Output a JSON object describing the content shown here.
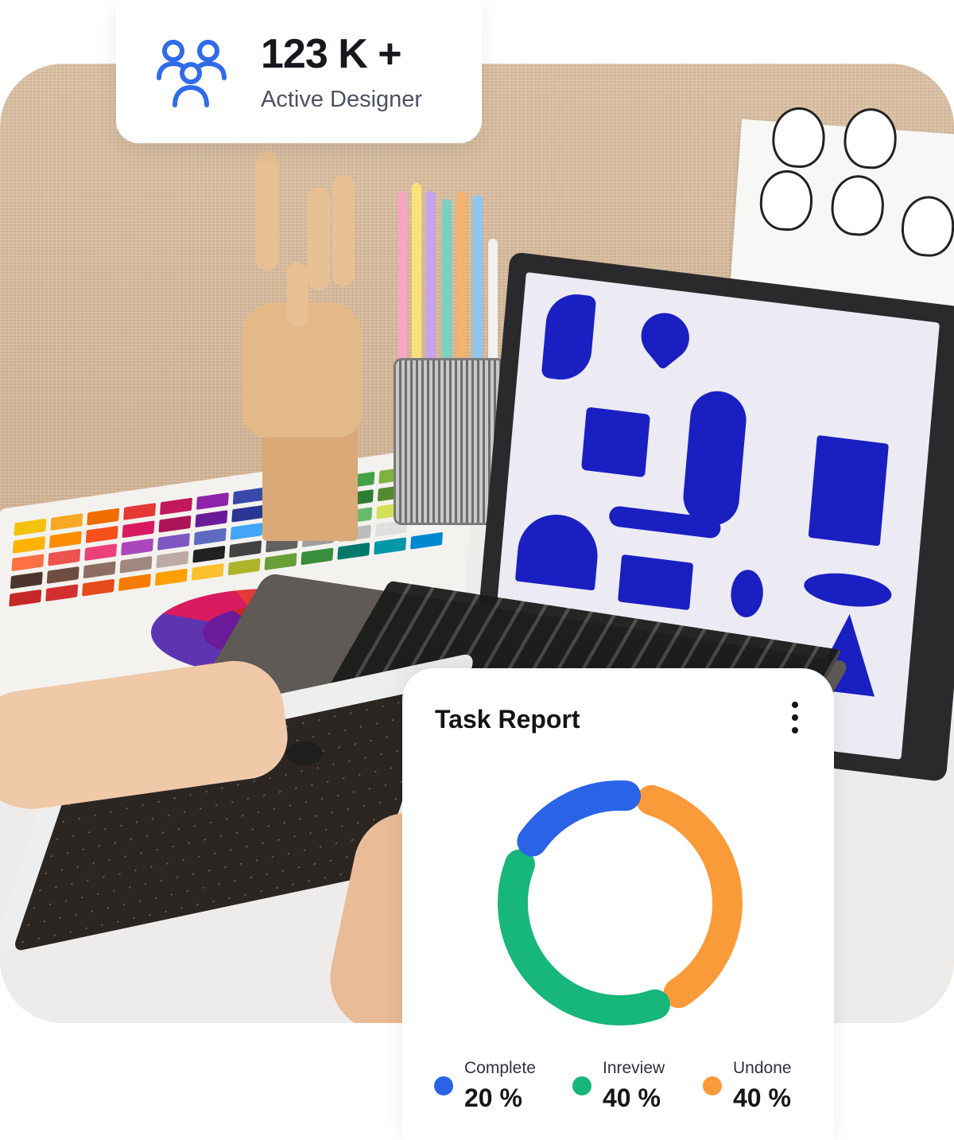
{
  "stat_card": {
    "icon": "users-icon",
    "value": "123 K +",
    "label": "Active Designer",
    "icon_color": "#2f6bea"
  },
  "report_card": {
    "title": "Task Report",
    "menu_icon": "kebab-menu-icon",
    "chart_data": {
      "type": "pie",
      "categories": [
        "Complete",
        "Inreview",
        "Undone"
      ],
      "values": [
        20,
        40,
        40
      ],
      "colors": [
        "#2a63e8",
        "#17b67a",
        "#fb9a38"
      ],
      "title": ""
    },
    "legend": [
      {
        "label": "Complete",
        "value": "20 %",
        "color": "#2a63e8"
      },
      {
        "label": "Inreview",
        "value": "40 %",
        "color": "#17b67a"
      },
      {
        "label": "Undone",
        "value": "40 %",
        "color": "#fb9a38"
      }
    ]
  }
}
